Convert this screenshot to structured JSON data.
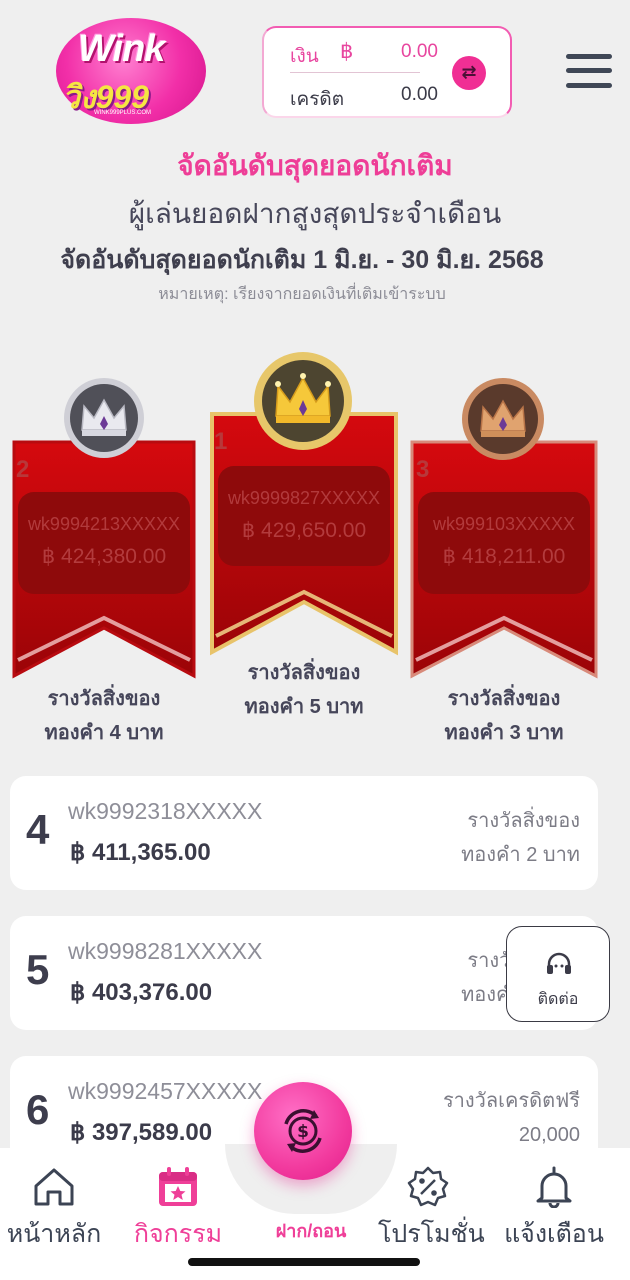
{
  "header": {
    "logo_text": "Wink",
    "logo_sub": "วิง999",
    "logo_url": "WINK999PLUS.COM",
    "wallet": {
      "balance_label": "เงิน",
      "currency_symbol": "฿",
      "balance_value": "0.00",
      "credit_label": "เครดิต",
      "credit_value": "0.00",
      "swap_icon": "swap-icon"
    },
    "menu_icon": "hamburger-menu-icon"
  },
  "titles": {
    "main": "จัดอันดับสุดยอดนักเติม",
    "sub": "ผู้เล่นยอดฝากสูงสุดประจำเดือน",
    "range": "จัดอันดับสุดยอดนักเติม 1 มิ.ย. - 30 มิ.ย. 2568",
    "note": "หมายเหตุ: เรียงจากยอดเงินที่เติมเข้าระบบ"
  },
  "podium": [
    {
      "rank": "2",
      "user": "wk9994213XXXXX",
      "amount": "฿ 424,380.00",
      "prize_line1": "รางวัลสิ่งของ",
      "prize_line2": "ทองคำ 4 บาท",
      "crown": "silver-crown-icon"
    },
    {
      "rank": "1",
      "user": "wk9999827XXXXX",
      "amount": "฿ 429,650.00",
      "prize_line1": "รางวัลสิ่งของ",
      "prize_line2": "ทองคำ 5 บาท",
      "crown": "gold-crown-icon"
    },
    {
      "rank": "3",
      "user": "wk999103XXXXX",
      "amount": "฿ 418,211.00",
      "prize_line1": "รางวัลสิ่งของ",
      "prize_line2": "ทองคำ 3 บาท",
      "crown": "bronze-crown-icon"
    }
  ],
  "list": [
    {
      "rank": "4",
      "user": "wk9992318XXXXX",
      "amount": "฿ 411,365.00",
      "prize_line1": "รางวัลสิ่งของ",
      "prize_line2": "ทองคำ 2 บาท"
    },
    {
      "rank": "5",
      "user": "wk9998281XXXXX",
      "amount": "฿ 403,376.00",
      "prize_line1": "รางวัลสิ่งของ",
      "prize_line2": "ทองคำ 1 บาท"
    },
    {
      "rank": "6",
      "user": "wk9992457XXXXX",
      "amount": "฿ 397,589.00",
      "prize_line1": "รางวัลเครดิตฟรี",
      "prize_line2": "20,000"
    }
  ],
  "contact": {
    "label": "ติดต่อ",
    "icon": "headset-icon"
  },
  "nav": {
    "home": "หน้าหลัก",
    "activities": "กิจกรรม",
    "deposit": "ฝาก/ถอน",
    "promotions": "โปรโมชั่น",
    "notifications": "แจ้งเตือน"
  },
  "colors": {
    "accent": "#ef3f98",
    "ribbon_red": "#c4070b",
    "gold": "#e7c76a",
    "silver": "#cfcfd6",
    "bronze": "#c98a62"
  }
}
